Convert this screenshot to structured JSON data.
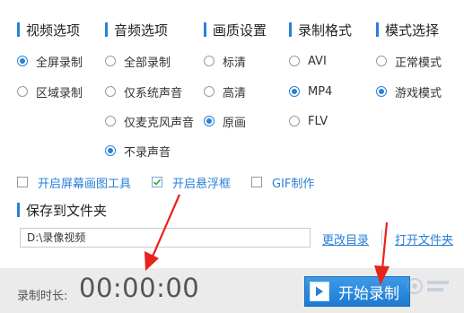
{
  "sections": {
    "video": {
      "title": "视频选项",
      "options": [
        "全屏录制",
        "区域录制"
      ],
      "selected": "全屏录制"
    },
    "audio": {
      "title": "音频选项",
      "options": [
        "全部录制",
        "仅系统声音",
        "仅麦克风声音",
        "不录声音"
      ],
      "selected": "不录声音"
    },
    "quality": {
      "title": "画质设置",
      "options": [
        "标清",
        "高清",
        "原画"
      ],
      "selected": "原画"
    },
    "format": {
      "title": "录制格式",
      "options": [
        "AVI",
        "MP4",
        "FLV"
      ],
      "selected": "MP4"
    },
    "mode": {
      "title": "模式选择",
      "options": [
        "正常模式",
        "游戏模式"
      ],
      "selected": "游戏模式"
    }
  },
  "checkboxes": [
    {
      "label": "开启屏幕画图工具",
      "checked": false
    },
    {
      "label": "开启悬浮框",
      "checked": true
    },
    {
      "label": "GIF制作",
      "checked": false
    }
  ],
  "save": {
    "title": "保存到文件夹",
    "path": "D:\\录像视频",
    "change_dir": "更改目录",
    "open_folder": "打开文件夹"
  },
  "footer": {
    "time_label": "录制时长:",
    "time_value": "00:00:00",
    "start_label": "开始录制"
  },
  "colors": {
    "accent": "#2a7fd8",
    "arrow": "#e8231b",
    "button": "#2a86dc"
  }
}
